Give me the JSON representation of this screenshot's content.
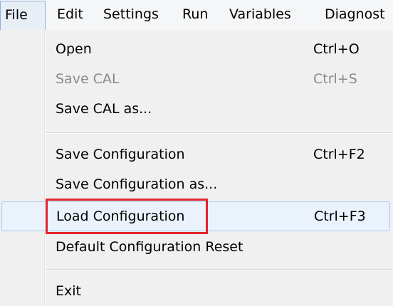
{
  "menubar": {
    "items": [
      {
        "label": "File",
        "active": true
      },
      {
        "label": "Edit"
      },
      {
        "label": "Settings"
      },
      {
        "label": "Run"
      },
      {
        "label": "Variables"
      },
      {
        "label": "Diagnost"
      }
    ]
  },
  "file_menu": {
    "items": [
      {
        "label": "Open",
        "shortcut": "Ctrl+O",
        "enabled": true
      },
      {
        "label": "Save CAL",
        "shortcut": "Ctrl+S",
        "enabled": false
      },
      {
        "label": "Save CAL as...",
        "shortcut": "",
        "enabled": true
      },
      {
        "label": "Save Configuration",
        "shortcut": "Ctrl+F2",
        "enabled": true
      },
      {
        "label": "Save Configuration as...",
        "shortcut": "",
        "enabled": true
      },
      {
        "label": "Load Configuration",
        "shortcut": "Ctrl+F3",
        "enabled": true,
        "hovered": true,
        "annotated": true
      },
      {
        "label": "Default Configuration Reset",
        "shortcut": "",
        "enabled": true
      },
      {
        "label": "Exit",
        "shortcut": "",
        "enabled": true
      }
    ]
  },
  "colors": {
    "annotation_box": "#e3242b",
    "hover_border": "#a9cdf0",
    "hover_fill": "#eaf2fb",
    "disabled_text": "#8a8a8a"
  }
}
